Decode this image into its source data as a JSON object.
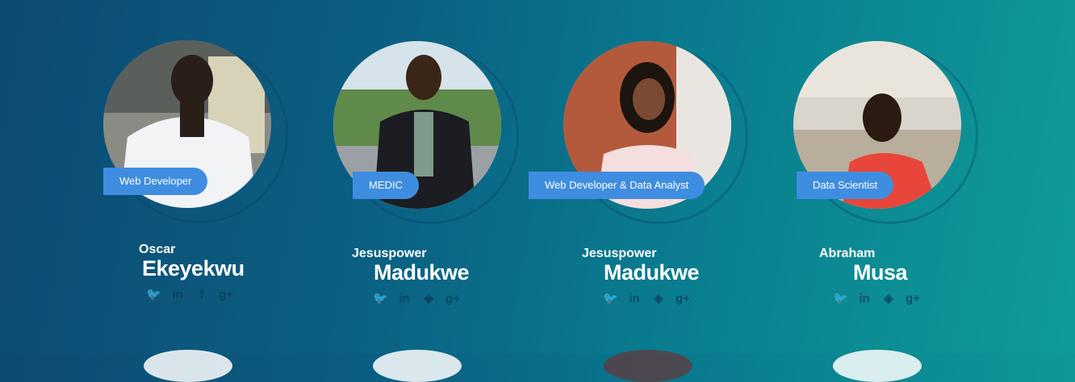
{
  "team": [
    {
      "role": "Web Developer",
      "first_name": "Oscar",
      "last_name": "Ekeyekwu",
      "social": [
        "twitter-icon",
        "linkedin-icon",
        "facebook-icon",
        "google-plus-icon"
      ]
    },
    {
      "role": "MEDIC",
      "first_name": "Jesuspower",
      "last_name": "Madukwe",
      "social": [
        "twitter-icon",
        "linkedin-icon",
        "stack-icon",
        "google-plus-icon"
      ]
    },
    {
      "role": "Web Developer & Data Analyst",
      "first_name": "Jesuspower",
      "last_name": "Madukwe",
      "social": [
        "twitter-icon",
        "linkedin-icon",
        "stack-icon",
        "google-plus-icon"
      ]
    },
    {
      "role": "Data Scientist",
      "first_name": "Abraham",
      "last_name": "Musa",
      "social": [
        "twitter-icon",
        "linkedin-icon",
        "stack-icon",
        "google-plus-icon"
      ]
    }
  ],
  "icon_glyphs": {
    "twitter": "🐦",
    "linkedin": "in",
    "facebook": "f",
    "stack": "◈",
    "google_plus": "g+"
  },
  "colors": {
    "role_badge": "#3f8de0",
    "icon": "#0a3d5a",
    "bg_start": "#0d4a72",
    "bg_end": "#0f9c98"
  }
}
